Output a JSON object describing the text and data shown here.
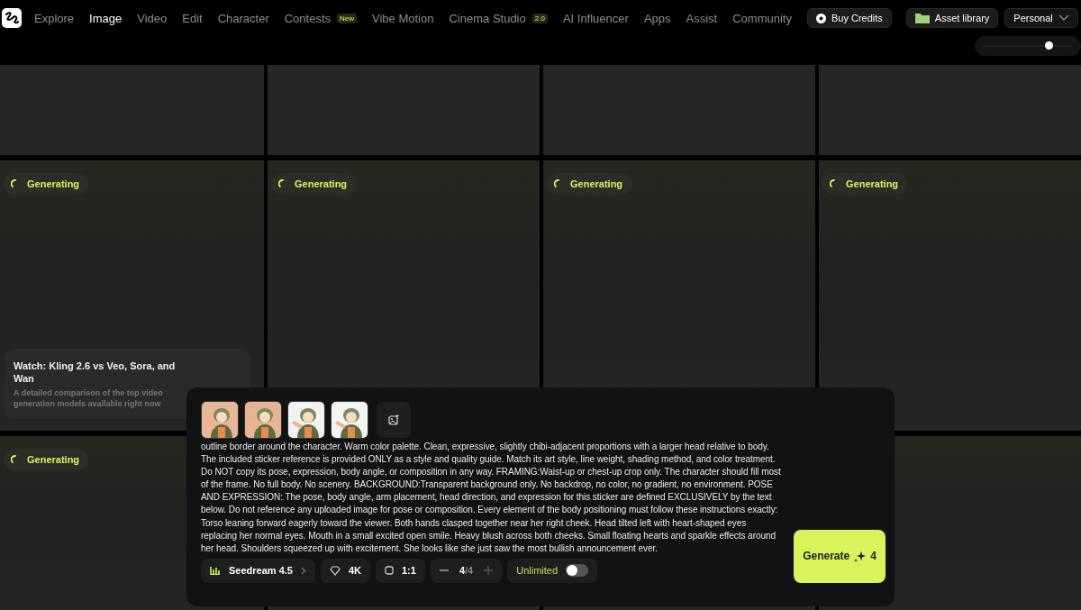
{
  "nav": [
    {
      "label": "Explore",
      "selected": false
    },
    {
      "label": "Image",
      "selected": true
    },
    {
      "label": "Video",
      "selected": false
    },
    {
      "label": "Edit",
      "selected": false
    },
    {
      "label": "Character",
      "selected": false
    },
    {
      "label": "Contests",
      "selected": false,
      "badge": "New"
    },
    {
      "label": "Vibe Motion",
      "selected": false
    },
    {
      "label": "Cinema Studio",
      "selected": false,
      "badge": "2.0"
    },
    {
      "label": "AI Influencer",
      "selected": false
    },
    {
      "label": "Apps",
      "selected": false
    },
    {
      "label": "Assist",
      "selected": false
    },
    {
      "label": "Community",
      "selected": false
    }
  ],
  "header_buttons": {
    "buy_credits": "Buy Credits",
    "asset_library": "Asset library",
    "workspace": "Personal"
  },
  "size_slider": {
    "level": 0.73
  },
  "grid_rows": [
    [
      {},
      {},
      {},
      {}
    ],
    [
      {
        "status": "Generating"
      },
      {
        "status": "Generating"
      },
      {
        "status": "Generating"
      },
      {
        "status": "Generating"
      }
    ],
    [
      {
        "status": "Generating"
      },
      {},
      {},
      {}
    ]
  ],
  "promo": {
    "title": "Watch: Kling 2.6 vs Veo, Sora, and Wan",
    "text": "A detailed comparison of the top video generation models available right now"
  },
  "prompt": {
    "text": "outline border around the character. Warm color palette. Clean, expressive, slightly chibi-adjacent proportions with a larger head relative to body. The included sticker reference is provided ONLY as a style and quality guide. Match its art style, line weight, shading method, and color treatment. Do NOT copy its pose, expression, body angle, or composition in any way. FRAMING:Waist-up or chest-up crop only. The character should fill most of the frame. No full body. No scenery. BACKGROUND:Transparent background only. No backdrop, no color, no gradient, no environment. POSE AND EXPRESSION: The pose, body angle, arm placement, head direction, and expression for this sticker are defined EXCLUSIVELY by the text below. Do not reference any uploaded image for pose or composition. Every element of the body positioning must follow these instructions exactly: Torso leaning forward eagerly toward the viewer. Both hands clasped together near her right cheek. Head tilted left with heart-shaped eyes replacing her normal eyes. Mouth in a small excited open smile. Heavy blush across both cheeks. Small floating hearts and sparkle effects around her head. Shoulders squeezed up with excitement. She looks like she just saw the most bullish announcement ever.",
    "model": "Seedream 4.5",
    "quality": "4K",
    "ratio": "1:1",
    "count": "4",
    "count_max": "/4",
    "unlimited": {
      "label": "Unlimited",
      "on": false
    },
    "generate": {
      "label": "Generate",
      "cost": "4"
    }
  }
}
